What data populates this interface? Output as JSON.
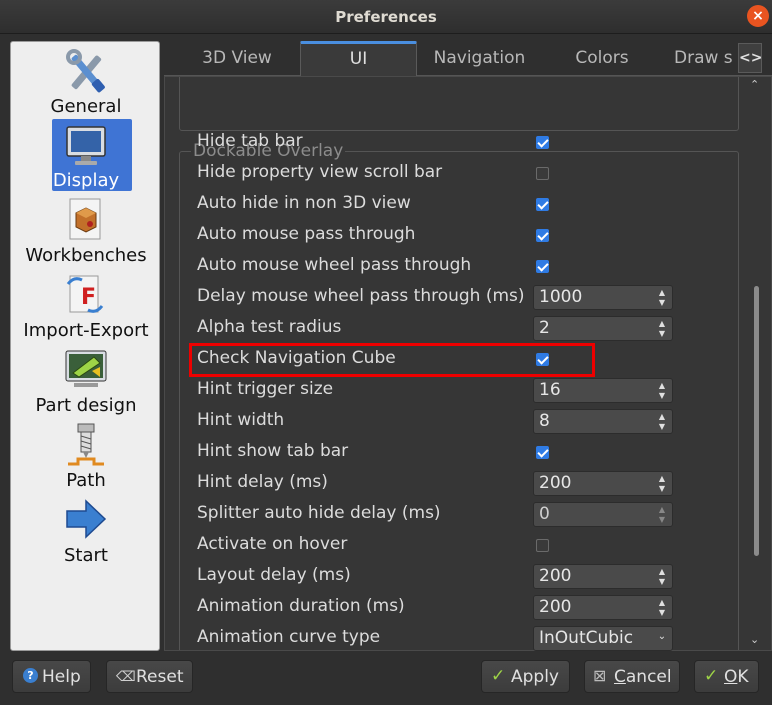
{
  "window": {
    "title": "Preferences",
    "close_icon": "×"
  },
  "sidebar": {
    "items": [
      {
        "label": "General",
        "icon": "tools-icon"
      },
      {
        "label": "Display",
        "icon": "monitor-icon",
        "selected": true
      },
      {
        "label": "Workbenches",
        "icon": "workbench-icon"
      },
      {
        "label": "Import-Export",
        "icon": "import-export-icon"
      },
      {
        "label": "Part design",
        "icon": "part-design-icon"
      },
      {
        "label": "Path",
        "icon": "path-icon"
      },
      {
        "label": "Start",
        "icon": "arrow-right-icon"
      }
    ]
  },
  "tabs": [
    {
      "label": "3D View"
    },
    {
      "label": "UI",
      "active": true
    },
    {
      "label": "Navigation"
    },
    {
      "label": "Colors"
    },
    {
      "label": "Draw s"
    }
  ],
  "group": {
    "title": "Dockable Overlay",
    "rows": [
      {
        "label": "Hide tab bar",
        "type": "checkbox",
        "checked": true
      },
      {
        "label": "Hide property view scroll bar",
        "type": "checkbox",
        "checked": false
      },
      {
        "label": "Auto hide in non 3D view",
        "type": "checkbox",
        "checked": true
      },
      {
        "label": "Auto mouse pass through",
        "type": "checkbox",
        "checked": true
      },
      {
        "label": "Auto mouse wheel pass through",
        "type": "checkbox",
        "checked": true
      },
      {
        "label": "Delay mouse wheel pass through (ms)",
        "type": "spin",
        "value": "1000"
      },
      {
        "label": "Alpha test radius",
        "type": "spin",
        "value": "2"
      },
      {
        "label": "Check Navigation Cube",
        "type": "checkbox",
        "checked": true,
        "highlighted": true
      },
      {
        "label": "Hint trigger size",
        "type": "spin",
        "value": "16"
      },
      {
        "label": "Hint width",
        "type": "spin",
        "value": "8"
      },
      {
        "label": "Hint show tab bar",
        "type": "checkbox",
        "checked": true
      },
      {
        "label": "Hint delay (ms)",
        "type": "spin",
        "value": "200"
      },
      {
        "label": "Splitter auto hide delay (ms)",
        "type": "spin",
        "value": "0",
        "disabled": true
      },
      {
        "label": "Activate on hover",
        "type": "checkbox",
        "checked": false
      },
      {
        "label": "Layout delay (ms)",
        "type": "spin",
        "value": "200"
      },
      {
        "label": "Animation duration (ms)",
        "type": "spin",
        "value": "200"
      },
      {
        "label": "Animation curve type",
        "type": "combo",
        "value": "InOutCubic"
      }
    ]
  },
  "footer": {
    "help": "Help",
    "reset": "Reset",
    "apply": "Apply",
    "cancel_prefix": "",
    "cancel_underline": "C",
    "cancel_rest": "ancel",
    "ok_underline": "O",
    "ok_rest": "K"
  },
  "colors": {
    "accent": "#3f74d4",
    "highlight_box": "#ee0000",
    "checkbox_on": "#2f7be4"
  }
}
